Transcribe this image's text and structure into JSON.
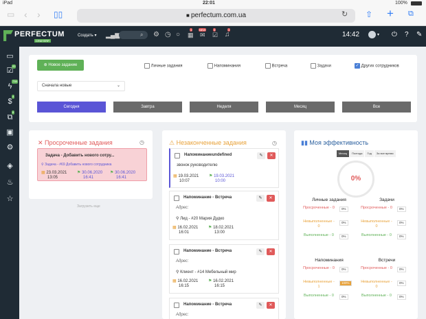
{
  "status": {
    "device": "iPad",
    "time": "22:01",
    "battery": "100%"
  },
  "browser": {
    "url": "perfectum.com.ua"
  },
  "app": {
    "logo": "PERFECTUM",
    "logo_sub": "CRM+ERP",
    "create_label": "Создать",
    "clock": "14:42",
    "badges": {
      "b1": "1",
      "b2": "NEW",
      "b3": "3",
      "b4": "1"
    }
  },
  "sidebar": {
    "badges": [
      "20",
      "738",
      "4",
      "6"
    ]
  },
  "filters": {
    "new_task": "Новое задание",
    "checks": [
      {
        "label": "Личные задания",
        "checked": false
      },
      {
        "label": "Напоминания",
        "checked": false
      },
      {
        "label": "Встреча",
        "checked": false
      },
      {
        "label": "Задачи",
        "checked": false
      },
      {
        "label": "Других сотрудников",
        "checked": true
      }
    ],
    "sort": "Сначала новые",
    "periods": [
      "Сегодня",
      "Завтра",
      "Неделя",
      "Месяц",
      "Все"
    ]
  },
  "overdue": {
    "title": "Просроченные задания",
    "task": {
      "title": "Задача - Добавить нового сотру...",
      "link": "Задача - #69 Добавить нового сотрудника",
      "d1": "23.03.2021",
      "t1": "13:05",
      "d2": "30.06.2020",
      "t2": "16:41",
      "d3": "30.06.2020",
      "t3": "16:41"
    },
    "load_more": "Загрузить еще"
  },
  "unfinished": {
    "title": "Незаконченные задания",
    "items": [
      {
        "title": "Напоминаниеundefined",
        "body": "звонок руководителю",
        "d1": "19.03.2021",
        "t1": "10:07",
        "d2": "19.03.2021",
        "t2": "10:00"
      },
      {
        "title": "Напоминание - Встреча",
        "body": "Адрес:",
        "link": "Лид - #20 Мария Дудко",
        "d1": "16.02.2021",
        "t1": "16:01",
        "d2": "18.02.2021",
        "t2": "13:00"
      },
      {
        "title": "Напоминание - Встреча",
        "body": "Адрес:",
        "link": "Клиент - #14 Мебельный мир",
        "d1": "16.02.2021",
        "t1": "16:15",
        "d2": "16.02.2021",
        "t2": "16:15"
      },
      {
        "title": "Напоминание - Встреча",
        "body": "Адрес:"
      }
    ]
  },
  "efficiency": {
    "title": "Моя эффективность",
    "tabs": [
      "Месяц",
      "Полгода",
      "Год",
      "За все время"
    ],
    "percent": "0%",
    "groups": [
      {
        "title": "Личные задания",
        "rows": [
          {
            "label": "Просроченные - 0",
            "val": "0%"
          },
          {
            "label": "Невыполненные - 0",
            "val": "0%"
          },
          {
            "label": "Выполненные - 0",
            "val": "0%"
          }
        ]
      },
      {
        "title": "Задачи",
        "rows": [
          {
            "label": "Просроченные - 0",
            "val": "0%"
          },
          {
            "label": "Невыполненные - 0",
            "val": "0%"
          },
          {
            "label": "Выполненные - 0",
            "val": "0%"
          }
        ]
      },
      {
        "title": "Напоминания",
        "rows": [
          {
            "label": "Просроченные - 0",
            "val": "0%"
          },
          {
            "label": "Невыполненные - 1",
            "val": "100%"
          },
          {
            "label": "Выполненные - 0",
            "val": "0%"
          }
        ]
      },
      {
        "title": "Встречи",
        "rows": [
          {
            "label": "Просроченные - 0",
            "val": "0%"
          },
          {
            "label": "Невыполненные - 0",
            "val": "0%"
          },
          {
            "label": "Выполненные - 0",
            "val": "0%"
          }
        ]
      }
    ]
  },
  "colors": {
    "green": "#5fb157",
    "purple": "#5a55d6",
    "gray": "#6a6a6a",
    "red": "#e05a5a",
    "orange": "#e8a23a",
    "nav": "#1f2b35"
  }
}
